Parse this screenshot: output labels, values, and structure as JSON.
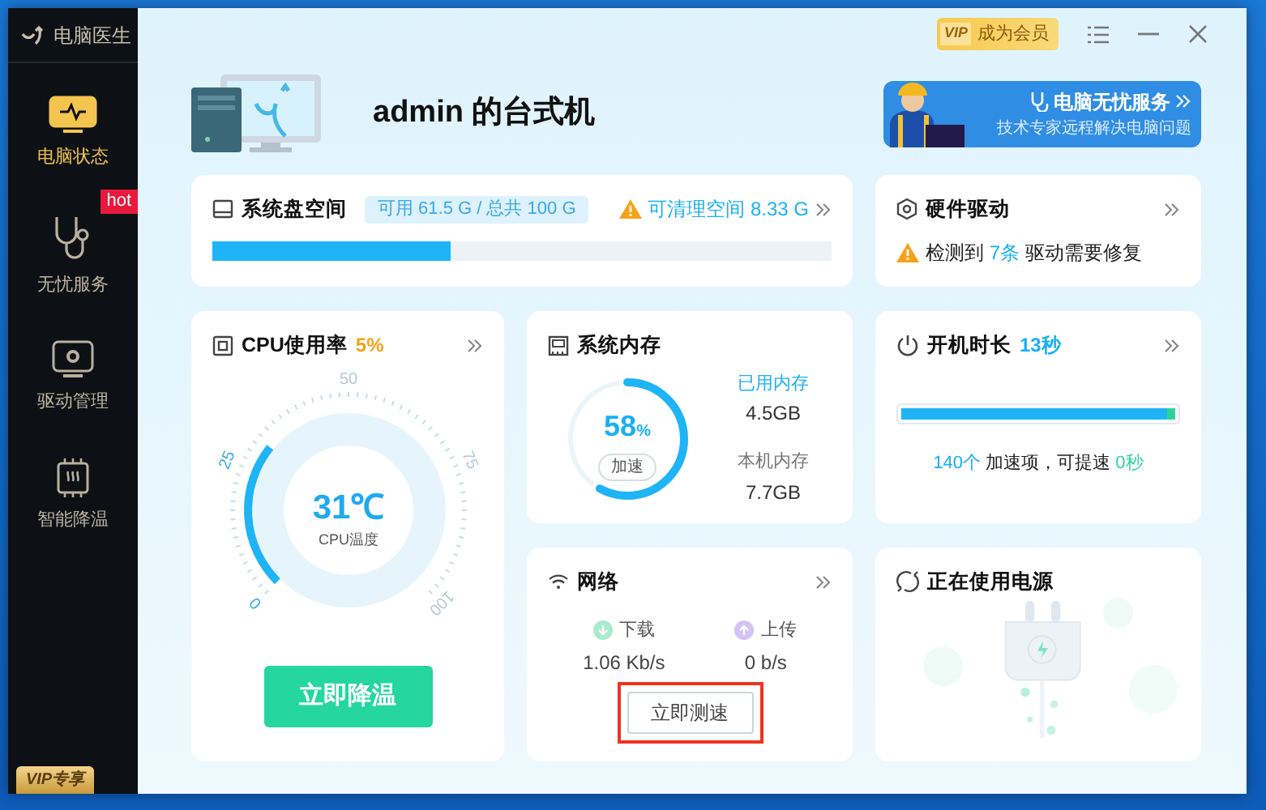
{
  "app": {
    "title": "电脑医生"
  },
  "sidebar": {
    "items": [
      {
        "label": "电脑状态",
        "kind": "monitor",
        "selected": true
      },
      {
        "label": "无忧服务",
        "kind": "stethoscope",
        "selected": false,
        "badge": "hot"
      },
      {
        "label": "驱动管理",
        "kind": "gear",
        "selected": false
      },
      {
        "label": "智能降温",
        "kind": "chip",
        "selected": false
      }
    ],
    "vip_badge": "VIP专享"
  },
  "titlebar": {
    "vip_mark": "VIP",
    "member_button": "成为会员"
  },
  "device": {
    "name": "admin 的台式机"
  },
  "service_banner": {
    "title": "电脑无忧服务",
    "subtitle": "技术专家远程解决电脑问题"
  },
  "disk": {
    "title": "系统盘空间",
    "usage": "可用 61.5 G / 总共 100 G",
    "cleanable": "可清理空间 8.33 G",
    "level": 0.385
  },
  "drivers": {
    "title": "硬件驱动",
    "prefix": "检测到",
    "count": "7条",
    "suffix": "驱动需要修复"
  },
  "cpu": {
    "title": "CPU使用率",
    "usage": "5%",
    "scale": [
      "0",
      "25",
      "50",
      "75",
      "100"
    ],
    "temperature": "31℃",
    "temperature_label": "CPU温度",
    "level": 0.31,
    "button": "立即降温"
  },
  "memory": {
    "title": "系统内存",
    "percent": "58",
    "unit": "%",
    "level": 0.58,
    "boost_button": "加速",
    "used_label": "已用内存",
    "used": "4.5GB",
    "total_label": "本机内存",
    "total": "7.7GB"
  },
  "boot": {
    "title": "开机时长",
    "time": "13秒",
    "level": 0.97,
    "count": "140个",
    "message": "加速项，可提速",
    "saving": "0秒"
  },
  "network": {
    "title": "网络",
    "download_label": "下载",
    "download": "1.06 Kb/s",
    "upload_label": "上传",
    "upload": "0 b/s",
    "button": "立即测速",
    "highlighted": true
  },
  "power": {
    "title": "正在使用电源"
  }
}
